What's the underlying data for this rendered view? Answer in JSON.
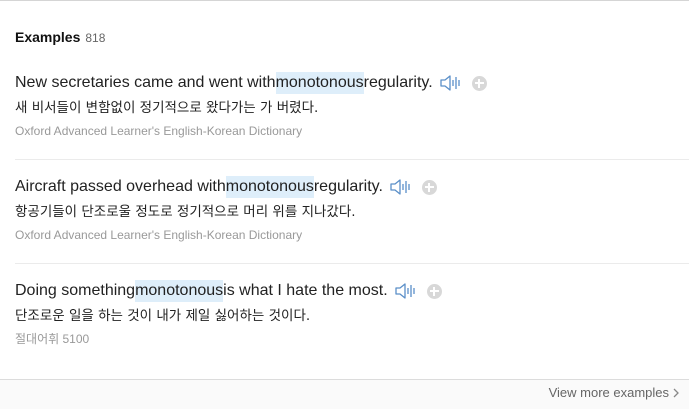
{
  "header": {
    "title": "Examples",
    "count": "818"
  },
  "examples": [
    {
      "before": "New secretaries came and went with ",
      "highlight": "monotonous",
      "after": " regularity.",
      "translation": "새 비서들이 변함없이 정기적으로 왔다가는 가 버렸다.",
      "source": "Oxford Advanced Learner's English-Korean Dictionary"
    },
    {
      "before": "Aircraft passed overhead with ",
      "highlight": "monotonous",
      "after": " regularity.",
      "translation": "항공기들이 단조로울 정도로 정기적으로 머리 위를 지나갔다.",
      "source": "Oxford Advanced Learner's English-Korean Dictionary"
    },
    {
      "before": "Doing something ",
      "highlight": "monotonous",
      "after": " is what I hate the most.",
      "translation": "단조로운 일을 하는 것이 내가 제일 싫어하는 것이다.",
      "source": "절대어휘 5100"
    }
  ],
  "footer": {
    "view_more": "View more examples"
  },
  "icons": {
    "speaker": "speaker-icon",
    "add": "plus-circle-icon",
    "chevron": "chevron-right-icon"
  },
  "colors": {
    "highlight": "#deeefa",
    "icon_blue": "#5a8fc8",
    "source_text": "#999999"
  }
}
